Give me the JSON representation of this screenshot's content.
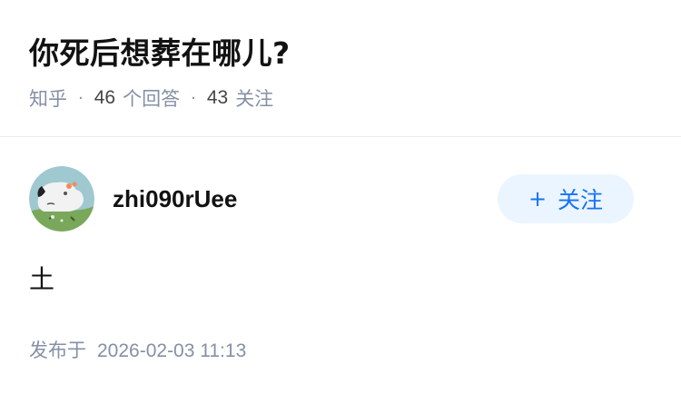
{
  "question": {
    "title": "你死后想葬在哪儿?",
    "source": "知乎",
    "answer_count": "46",
    "answer_label": "个回答",
    "follower_count": "43",
    "follower_label": "关注",
    "separator": "·"
  },
  "answer": {
    "author_name": "zhi090rUee",
    "avatar_icon": "cartoon-dog-avatar",
    "follow_button_plus": "+",
    "follow_button_label": "关注",
    "content": "土",
    "published_prefix": "发布于",
    "published_time": "2026-02-03 11:13"
  },
  "colors": {
    "accent": "#1772f6",
    "follow_bg": "#ebf5ff",
    "meta_gray": "#8590a6",
    "title": "#121212"
  }
}
